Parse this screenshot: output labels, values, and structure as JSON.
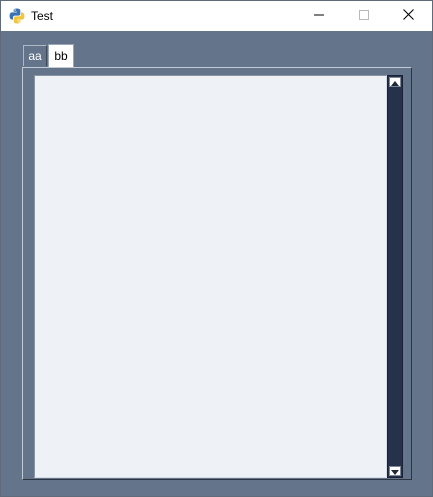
{
  "window": {
    "title": "Test",
    "app_icon": "python-icon",
    "controls": {
      "minimize_icon": "minimize-icon",
      "maximize_icon": "maximize-icon",
      "close_icon": "close-icon"
    }
  },
  "tabs": [
    {
      "label": "aa",
      "selected": true
    },
    {
      "label": "bb",
      "selected": false
    }
  ],
  "text_area": {
    "value": ""
  },
  "scrollbar": {
    "up_icon": "scroll-up-arrow-icon",
    "down_icon": "scroll-down-arrow-icon"
  },
  "colors": {
    "background": "#64748b",
    "text_area": "#eef2f7",
    "scrollbar_track": "#26324c"
  }
}
